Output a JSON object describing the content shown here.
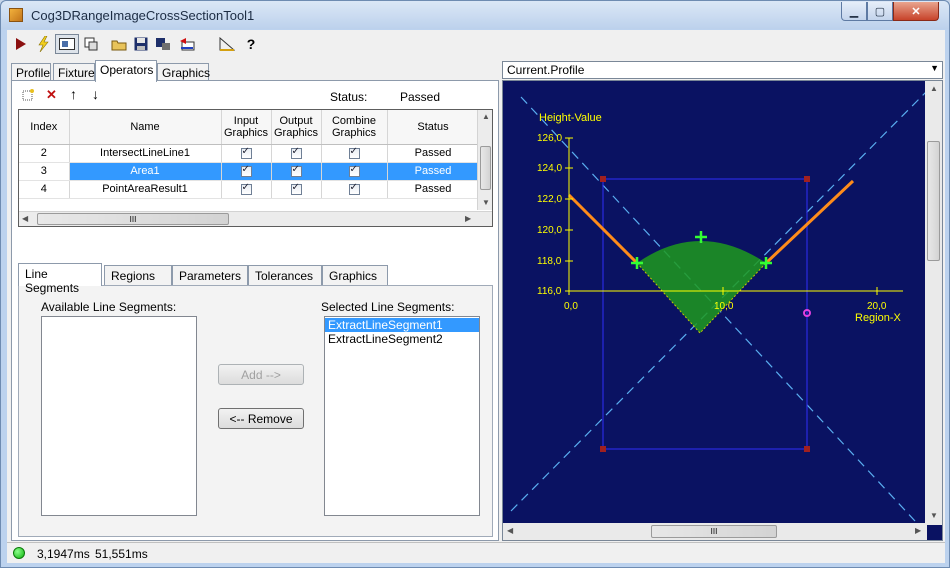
{
  "window": {
    "title": "Cog3DRangeImageCrossSectionTool1",
    "min_label": "▁",
    "max_label": "▢",
    "close_label": "✕"
  },
  "toolbar": {
    "icons": [
      "run-icon",
      "lightning-icon",
      "image-view-icon",
      "pin-icon",
      "open-folder-icon",
      "save-icon",
      "save-settings-icon",
      "reset-icon",
      "ruler-icon",
      "help-icon"
    ]
  },
  "main_tabs": [
    "Profile",
    "Fixture",
    "Operators",
    "Graphics"
  ],
  "operators": {
    "status_label": "Status:",
    "status_value": "Passed",
    "columns": [
      "Index",
      "Name",
      "Input Graphics",
      "Output Graphics",
      "Combine Graphics",
      "Status"
    ],
    "rows": [
      {
        "index": "2",
        "name": "IntersectLineLine1",
        "status": "Passed"
      },
      {
        "index": "3",
        "name": "Area1",
        "status": "Passed"
      },
      {
        "index": "4",
        "name": "PointAreaResult1",
        "status": "Passed"
      }
    ],
    "scroll_grip": "III"
  },
  "sub_tabs": [
    "Line Segments",
    "Regions",
    "Parameters",
    "Tolerances",
    "Graphics"
  ],
  "line_segments": {
    "available_label": "Available Line Segments:",
    "selected_label": "Selected Line Segments:",
    "selected_items": [
      "ExtractLineSegment1",
      "ExtractLineSegment2"
    ],
    "add_label": "Add -->",
    "remove_label": "<-- Remove"
  },
  "display": {
    "dropdown_value": "Current.Profile",
    "y_title": "Height-Value",
    "x_title": "Region-X",
    "y_ticks": [
      "126,0",
      "124,0",
      "122,0",
      "120,0",
      "118,0",
      "116,0"
    ],
    "x_ticks": [
      "0,0",
      "10,0",
      "20,0"
    ],
    "scroll_grip": "III",
    "colors": {
      "background": "#0a1262",
      "axis": "#ffff00",
      "profile": "#ff8c1a",
      "area_fill": "#1f9a1f",
      "marker": "#33ff33",
      "guide_line": "#5aaef0",
      "region_box": "#2a2ae0"
    }
  },
  "statusbar": {
    "time1": "3,1947ms",
    "time2": "51,551ms"
  }
}
